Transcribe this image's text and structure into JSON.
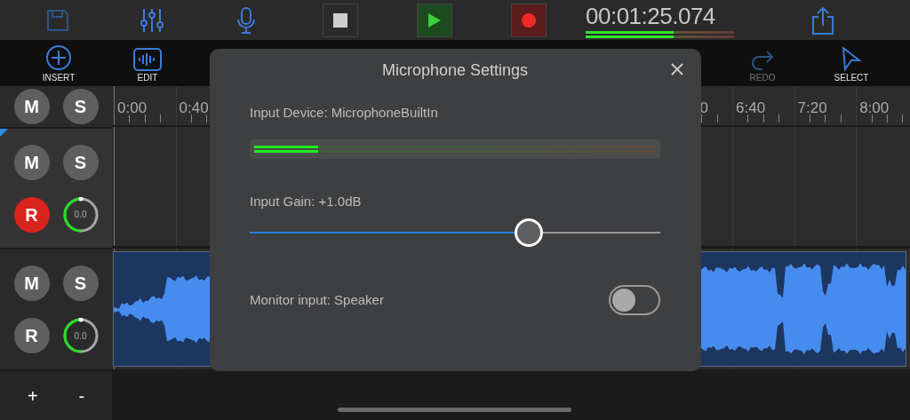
{
  "transport": [
    {
      "kind": "save",
      "disabled": true
    },
    {
      "kind": "mixer",
      "disabled": false
    },
    {
      "kind": "mic",
      "disabled": false
    },
    {
      "kind": "stop",
      "disabled": false
    },
    {
      "kind": "play",
      "disabled": false
    },
    {
      "kind": "record",
      "disabled": false
    }
  ],
  "time": "00:01:25.074",
  "output_meter": [
    {
      "level": 0.59
    },
    {
      "level": 0.59
    }
  ],
  "toolbar_left": [
    {
      "kind": "insert",
      "label": "INSERT",
      "disabled": false
    },
    {
      "kind": "edit",
      "label": "EDIT",
      "disabled": false
    }
  ],
  "toolbar_right": [
    {
      "kind": "redo",
      "label": "REDO",
      "disabled": true
    },
    {
      "kind": "select",
      "label": "SELECT",
      "disabled": false
    }
  ],
  "master": {
    "mute": "M",
    "solo": "S"
  },
  "ruler": [
    "0:00",
    "0:40",
    "0",
    "6:40",
    "7:20",
    "8:00"
  ],
  "tracks": [
    {
      "selected": true,
      "mute": "M",
      "solo": "S",
      "record": "R",
      "armed": true,
      "volume": "0.0",
      "level": 0.5
    },
    {
      "selected": false,
      "mute": "M",
      "solo": "S",
      "record": "R",
      "armed": false,
      "volume": "0.0",
      "level": 0.5
    }
  ],
  "add": "+",
  "remove": "-",
  "dialog": {
    "title": "Microphone Settings",
    "device": "Input Device: MicrophoneBuiltIn",
    "input_meter": [
      {
        "level": 0.16
      },
      {
        "level": 0.16
      }
    ],
    "gain": "Input Gain: +1.0dB",
    "gain_slider": {
      "level": 0.68
    },
    "monitor": "Monitor input: Speaker",
    "monitor_toggle": {
      "on": false
    }
  }
}
